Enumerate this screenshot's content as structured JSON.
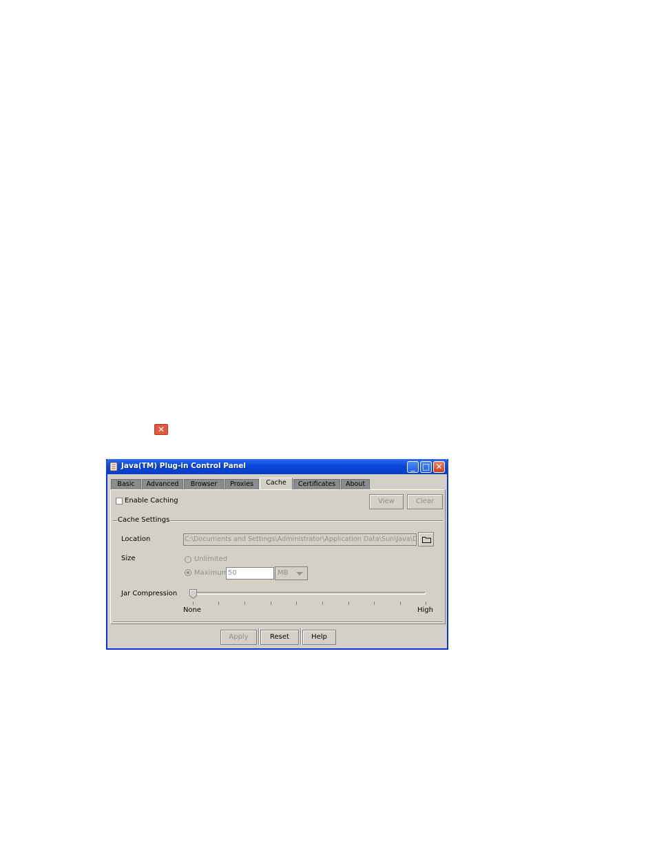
{
  "broken_image_icon": "broken-image-icon",
  "window": {
    "title": "Java(TM) Plug-in Control Panel",
    "controls": {
      "minimize": "_",
      "maximize": "□",
      "close": "✕"
    },
    "accent": "#0a46d8"
  },
  "tabs": [
    {
      "label": "Basic",
      "active": false
    },
    {
      "label": "Advanced",
      "active": false
    },
    {
      "label": "Browser",
      "active": false
    },
    {
      "label": "Proxies",
      "active": false
    },
    {
      "label": "Cache",
      "active": true
    },
    {
      "label": "Certificates",
      "active": false
    },
    {
      "label": "About",
      "active": false
    }
  ],
  "cache": {
    "enable_caching_label": "Enable Caching",
    "enable_caching_checked": false,
    "view_label": "View",
    "clear_label": "Clear",
    "settings_group_label": "Cache Settings",
    "location_label": "Location",
    "location_value": "C:\\Documents and Settings\\Administrator\\Application Data\\Sun\\Java\\Dep",
    "size_label": "Size",
    "unlimited_label": "Unlimited",
    "maximum_label": "Maximum",
    "maximum_value": "50",
    "unit_value": "MB",
    "jar_compression_label": "Jar Compression",
    "compression_min_label": "None",
    "compression_max_label": "High",
    "compression_level": 0
  },
  "footer": {
    "apply_label": "Apply",
    "reset_label": "Reset",
    "help_label": "Help"
  }
}
